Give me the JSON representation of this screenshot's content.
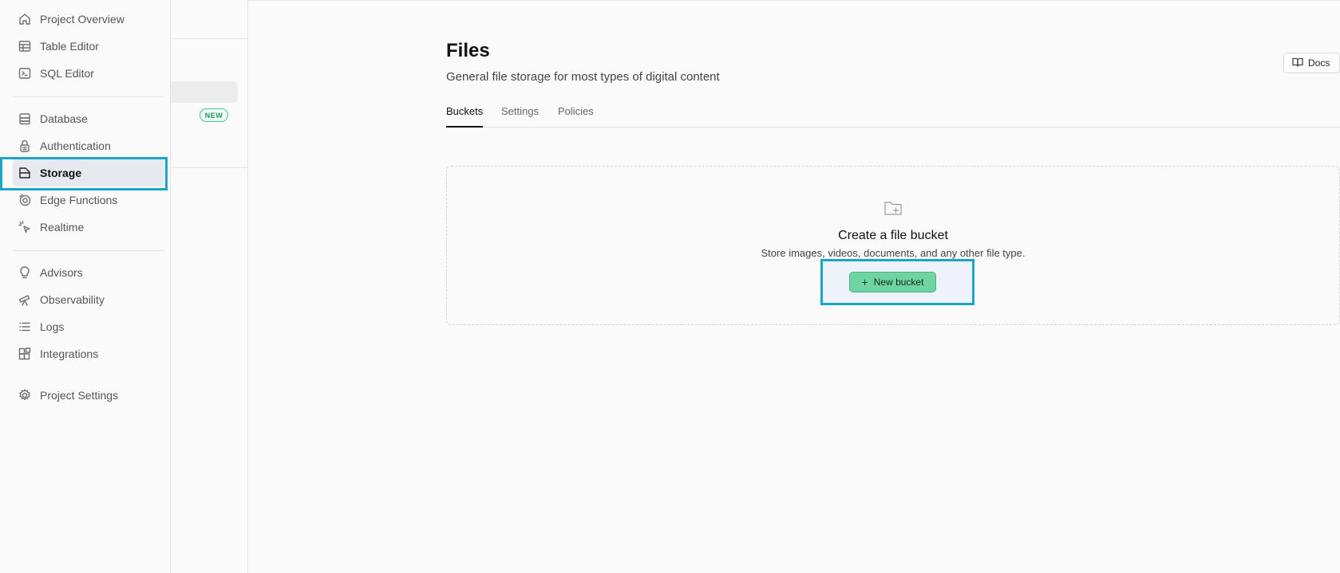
{
  "nav": {
    "items": [
      {
        "label": "Project Overview",
        "icon": "home-icon"
      },
      {
        "label": "Table Editor",
        "icon": "table-icon"
      },
      {
        "label": "SQL Editor",
        "icon": "terminal-icon"
      },
      {
        "label": "Database",
        "icon": "database-icon"
      },
      {
        "label": "Authentication",
        "icon": "lock-icon"
      },
      {
        "label": "Storage",
        "icon": "storage-icon",
        "active": true
      },
      {
        "label": "Edge Functions",
        "icon": "globe-icon"
      },
      {
        "label": "Realtime",
        "icon": "cursor-icon"
      },
      {
        "label": "Advisors",
        "icon": "lightbulb-icon"
      },
      {
        "label": "Observability",
        "icon": "telescope-icon"
      },
      {
        "label": "Logs",
        "icon": "list-icon"
      },
      {
        "label": "Integrations",
        "icon": "blocks-icon"
      },
      {
        "label": "Project Settings",
        "icon": "gear-icon"
      }
    ]
  },
  "mid": {
    "badge": "NEW"
  },
  "header": {
    "title": "Files",
    "subtitle": "General file storage for most types of digital content",
    "docs_label": "Docs"
  },
  "tabs": [
    {
      "label": "Buckets",
      "active": true
    },
    {
      "label": "Settings"
    },
    {
      "label": "Policies"
    }
  ],
  "empty_state": {
    "title": "Create a file bucket",
    "description": "Store images, videos, documents, and any other file type.",
    "button_label": "New bucket"
  },
  "colors": {
    "accent": "#3ecf8e",
    "highlight": "#1aa7c7"
  }
}
